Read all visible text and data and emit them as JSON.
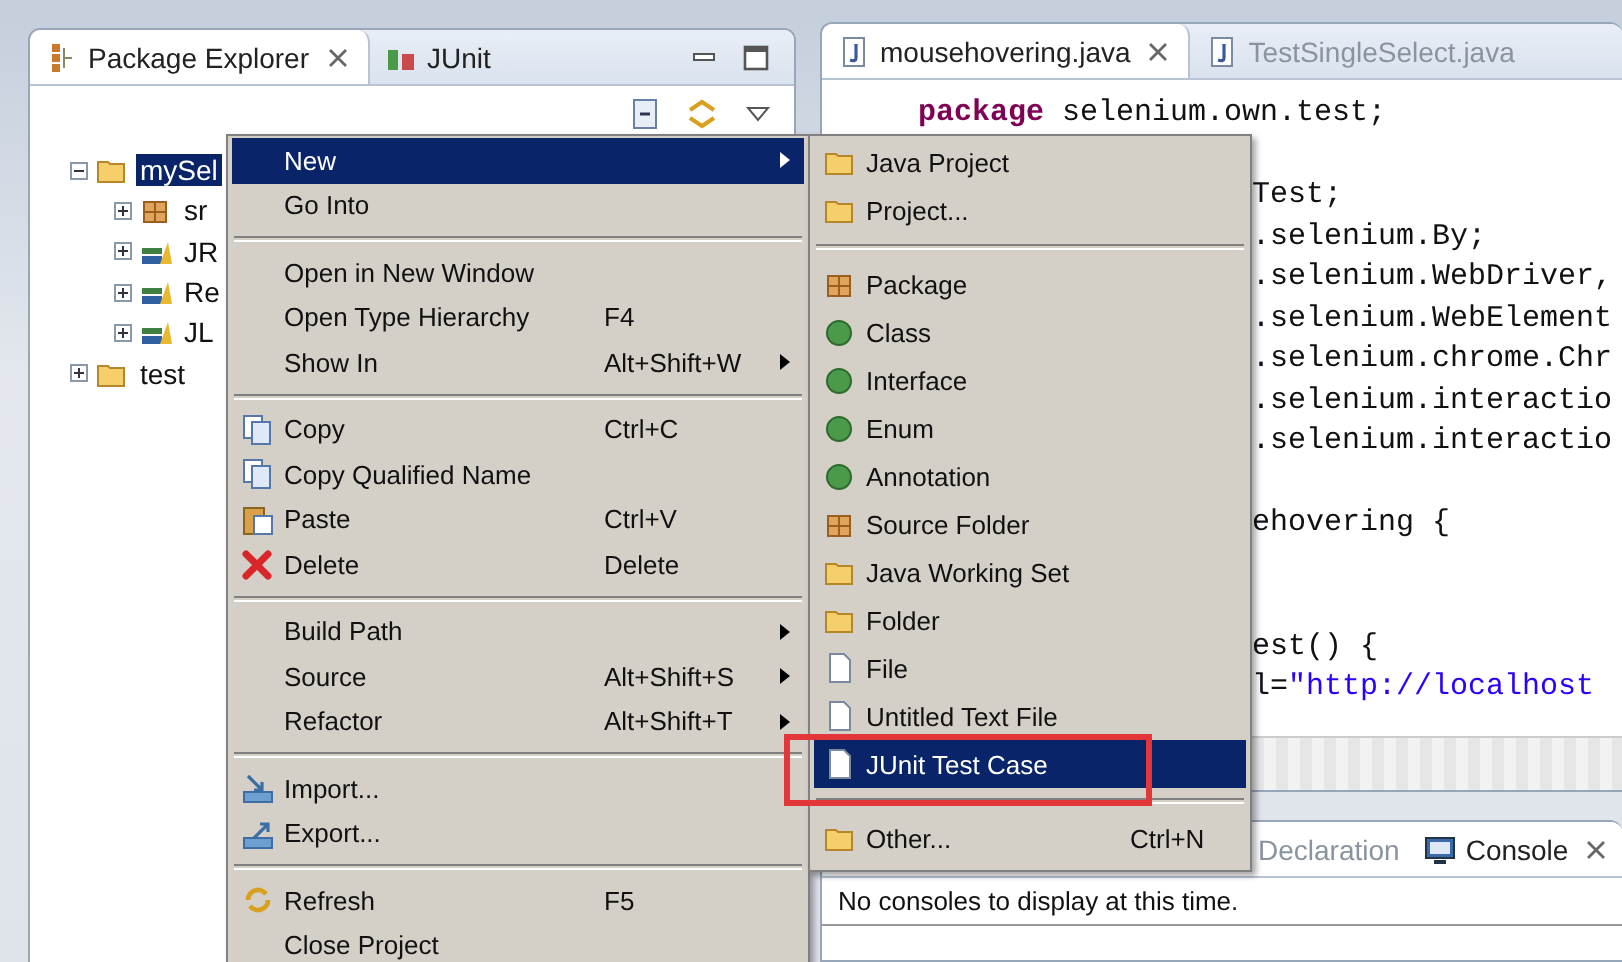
{
  "explorer": {
    "tabs": [
      {
        "label": "Package Explorer",
        "selected": true,
        "closable": true
      },
      {
        "label": "JUnit",
        "selected": false,
        "closable": false
      }
    ],
    "tree": [
      {
        "label": "mySel",
        "kind": "project",
        "selected": true,
        "expanded": true,
        "children": [
          {
            "label": "sr",
            "kind": "source_folder",
            "selected": false,
            "expanded": false
          },
          {
            "label": "JR",
            "kind": "library",
            "selected": false,
            "expanded": false
          },
          {
            "label": "Re",
            "kind": "library",
            "selected": false,
            "expanded": false
          },
          {
            "label": "JL",
            "kind": "library",
            "selected": false,
            "expanded": false
          }
        ]
      },
      {
        "label": "test",
        "kind": "project",
        "selected": false,
        "expanded": false
      }
    ]
  },
  "editor": {
    "tabs": [
      {
        "label": "mousehovering.java",
        "selected": true,
        "closable": true
      },
      {
        "label": "TestSingleSelect.java",
        "selected": false,
        "closable": false
      }
    ],
    "lines": [
      {
        "kind": "full",
        "segments": [
          {
            "kind": "keyword",
            "text": "package"
          },
          {
            "kind": "plain",
            "text": " selenium.own.test;"
          }
        ]
      },
      {
        "kind": "blank"
      },
      {
        "kind": "clipped",
        "segments": [
          {
            "kind": "plain",
            "text": "Test;"
          }
        ]
      },
      {
        "kind": "clipped",
        "segments": [
          {
            "kind": "plain",
            "text": ".selenium.By;"
          }
        ]
      },
      {
        "kind": "clipped",
        "segments": [
          {
            "kind": "plain",
            "text": ".selenium.WebDriver,"
          }
        ]
      },
      {
        "kind": "clipped",
        "segments": [
          {
            "kind": "plain",
            "text": ".selenium.WebElement"
          }
        ]
      },
      {
        "kind": "clipped",
        "segments": [
          {
            "kind": "plain",
            "text": ".selenium.chrome.Chr"
          }
        ]
      },
      {
        "kind": "clipped",
        "segments": [
          {
            "kind": "plain",
            "text": ".selenium.interactio"
          }
        ]
      },
      {
        "kind": "clipped",
        "segments": [
          {
            "kind": "plain",
            "text": ".selenium.interactio"
          }
        ]
      },
      {
        "kind": "blank"
      },
      {
        "kind": "clipped",
        "segments": [
          {
            "kind": "plain",
            "text": "ehovering {"
          }
        ]
      },
      {
        "kind": "blank"
      },
      {
        "kind": "blank"
      },
      {
        "kind": "clipped",
        "segments": [
          {
            "kind": "plain",
            "text": "est() {"
          }
        ]
      },
      {
        "kind": "clipped",
        "segments": [
          {
            "kind": "plain",
            "text": "l="
          },
          {
            "kind": "string",
            "text": "\"http://localhost"
          }
        ]
      }
    ]
  },
  "bottom_panel": {
    "tabs": [
      {
        "label": "Declaration",
        "selected": false,
        "closable": false
      },
      {
        "label": "Console",
        "selected": true,
        "closable": true
      }
    ],
    "message": "No consoles to display at this time."
  },
  "context_menu": {
    "items": [
      {
        "kind": "item",
        "label": "New",
        "submenu": true,
        "selected": true
      },
      {
        "kind": "item",
        "label": "Go Into",
        "submenu": false,
        "selected": false
      },
      {
        "kind": "separator"
      },
      {
        "kind": "item",
        "label": "Open in New Window",
        "submenu": false,
        "selected": false
      },
      {
        "kind": "item",
        "label": "Open Type Hierarchy",
        "shortcut": "F4",
        "submenu": false,
        "selected": false
      },
      {
        "kind": "item",
        "label": "Show In",
        "shortcut": "Alt+Shift+W",
        "submenu": true,
        "selected": false
      },
      {
        "kind": "separator"
      },
      {
        "kind": "item",
        "label": "Copy",
        "shortcut": "Ctrl+C",
        "submenu": false,
        "selected": false
      },
      {
        "kind": "item",
        "label": "Copy Qualified Name",
        "submenu": false,
        "selected": false
      },
      {
        "kind": "item",
        "label": "Paste",
        "shortcut": "Ctrl+V",
        "submenu": false,
        "selected": false
      },
      {
        "kind": "item",
        "label": "Delete",
        "shortcut": "Delete",
        "submenu": false,
        "selected": false
      },
      {
        "kind": "separator"
      },
      {
        "kind": "item",
        "label": "Build Path",
        "submenu": true,
        "selected": false
      },
      {
        "kind": "item",
        "label": "Source",
        "shortcut": "Alt+Shift+S",
        "submenu": true,
        "selected": false
      },
      {
        "kind": "item",
        "label": "Refactor",
        "shortcut": "Alt+Shift+T",
        "submenu": true,
        "selected": false
      },
      {
        "kind": "separator"
      },
      {
        "kind": "item",
        "label": "Import...",
        "submenu": false,
        "selected": false
      },
      {
        "kind": "item",
        "label": "Export...",
        "submenu": false,
        "selected": false
      },
      {
        "kind": "separator"
      },
      {
        "kind": "item",
        "label": "Refresh",
        "shortcut": "F5",
        "submenu": false,
        "selected": false
      },
      {
        "kind": "item",
        "label": "Close Project",
        "submenu": false,
        "selected": false
      }
    ]
  },
  "new_submenu": {
    "items": [
      {
        "kind": "item",
        "label": "Java Project",
        "selected": false
      },
      {
        "kind": "item",
        "label": "Project...",
        "selected": false
      },
      {
        "kind": "separator"
      },
      {
        "kind": "item",
        "label": "Package",
        "selected": false
      },
      {
        "kind": "item",
        "label": "Class",
        "selected": false
      },
      {
        "kind": "item",
        "label": "Interface",
        "selected": false
      },
      {
        "kind": "item",
        "label": "Enum",
        "selected": false
      },
      {
        "kind": "item",
        "label": "Annotation",
        "selected": false
      },
      {
        "kind": "item",
        "label": "Source Folder",
        "selected": false
      },
      {
        "kind": "item",
        "label": "Java Working Set",
        "selected": false
      },
      {
        "kind": "item",
        "label": "Folder",
        "selected": false
      },
      {
        "kind": "item",
        "label": "File",
        "selected": false
      },
      {
        "kind": "item",
        "label": "Untitled Text File",
        "selected": false
      },
      {
        "kind": "item",
        "label": "JUnit Test Case",
        "selected": true
      },
      {
        "kind": "separator"
      },
      {
        "kind": "item",
        "label": "Other...",
        "shortcut": "Ctrl+N",
        "selected": false
      }
    ]
  }
}
